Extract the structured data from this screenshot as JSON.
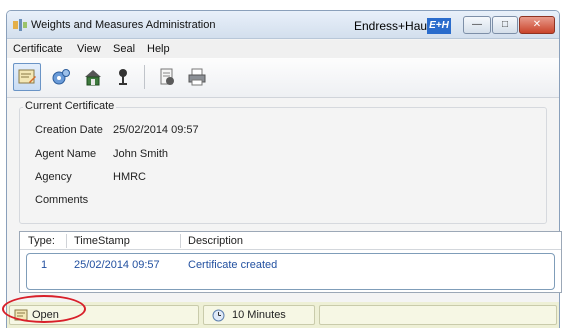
{
  "window": {
    "title": "Weights and Measures Administration",
    "brand": "Endress+Hauser",
    "brand_logo": "E+H",
    "controls": {
      "minimize": "—",
      "maximize": "□",
      "close": "✕"
    }
  },
  "menu": [
    "Certificate",
    "View",
    "Seal",
    "Help"
  ],
  "toolbar": {
    "icons": [
      "certificate-edit-icon",
      "settings-icon",
      "lock-icon",
      "seal-icon",
      "report-icon",
      "print-icon"
    ]
  },
  "current_certificate": {
    "group_label": "Current Certificate",
    "fields": [
      {
        "label": "Creation Date",
        "value": "25/02/2014 09:57"
      },
      {
        "label": "Agent Name",
        "value": "John Smith"
      },
      {
        "label": "Agency",
        "value": "HMRC"
      },
      {
        "label": "Comments",
        "value": ""
      }
    ]
  },
  "history": {
    "columns": [
      "Type:",
      "TimeStamp",
      "Description"
    ],
    "rows": [
      {
        "type": "1",
        "timestamp": "25/02/2014 09:57",
        "description": "Certificate created"
      }
    ]
  },
  "status": {
    "state": "Open",
    "timeout": "10 Minutes"
  },
  "colors": {
    "accent": "#2a6ccc",
    "highlight_circle": "#d8202a",
    "row_text": "#2250a0"
  }
}
